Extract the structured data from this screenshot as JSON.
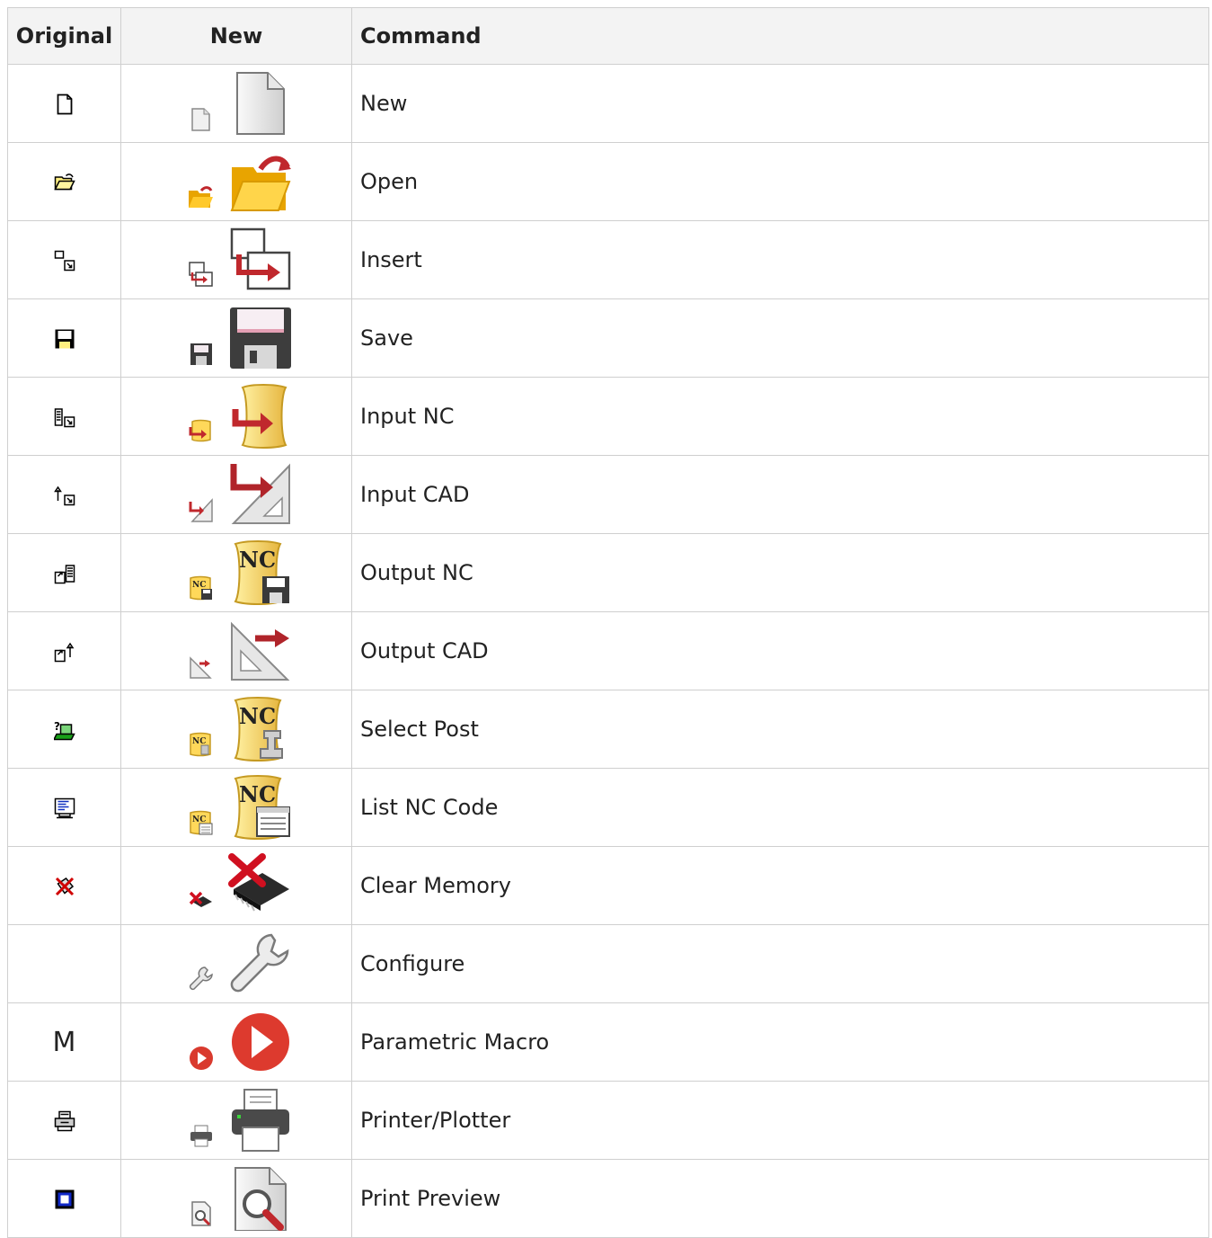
{
  "headers": {
    "original": "Original",
    "new": "New",
    "command": "Command"
  },
  "rows": [
    {
      "command": "New",
      "orig_icon": "new-document-icon",
      "new_icon": "new-document-icon"
    },
    {
      "command": "Open",
      "orig_icon": "open-folder-icon",
      "new_icon": "open-folder-icon"
    },
    {
      "command": "Insert",
      "orig_icon": "insert-icon",
      "new_icon": "insert-icon"
    },
    {
      "command": "Save",
      "orig_icon": "save-disk-icon",
      "new_icon": "save-disk-icon"
    },
    {
      "command": "Input NC",
      "orig_icon": "input-nc-icon",
      "new_icon": "input-nc-icon"
    },
    {
      "command": "Input CAD",
      "orig_icon": "input-cad-icon",
      "new_icon": "input-cad-icon"
    },
    {
      "command": "Output NC",
      "orig_icon": "output-nc-icon",
      "new_icon": "output-nc-icon"
    },
    {
      "command": "Output CAD",
      "orig_icon": "output-cad-icon",
      "new_icon": "output-cad-icon"
    },
    {
      "command": "Select Post",
      "orig_icon": "select-post-icon",
      "new_icon": "select-post-icon"
    },
    {
      "command": "List NC Code",
      "orig_icon": "list-nc-code-icon",
      "new_icon": "list-nc-code-icon"
    },
    {
      "command": "Clear Memory",
      "orig_icon": "clear-memory-icon",
      "new_icon": "clear-memory-icon"
    },
    {
      "command": "Configure",
      "orig_icon": "",
      "new_icon": "wrench-icon"
    },
    {
      "command": "Parametric Macro",
      "orig_icon": "macro-m-icon",
      "new_icon": "play-icon",
      "orig_text": "M"
    },
    {
      "command": "Printer/Plotter",
      "orig_icon": "printer-icon",
      "new_icon": "printer-icon"
    },
    {
      "command": "Print Preview",
      "orig_icon": "print-preview-icon",
      "new_icon": "print-preview-icon"
    }
  ]
}
